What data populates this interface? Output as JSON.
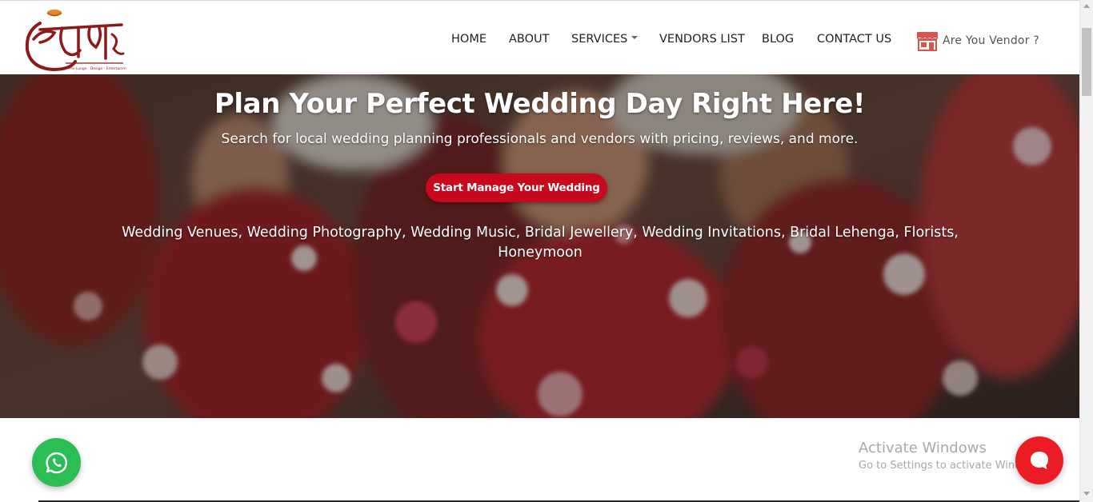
{
  "header": {
    "logo_alt": "शुभारंभ",
    "nav": [
      {
        "label": "HOME"
      },
      {
        "label": "ABOUT"
      },
      {
        "label": "SERVICES",
        "has_dropdown": true
      },
      {
        "label": "VENDORS LIST"
      },
      {
        "label": "BLOG"
      },
      {
        "label": "CONTACT US"
      }
    ],
    "vendor_link": {
      "label": "Are You Vendor ?",
      "icon": "store-icon"
    }
  },
  "hero": {
    "title": "Plan Your Perfect Wedding Day Right Here!",
    "subtitle": "Search for local wedding planning professionals and vendors with pricing, reviews, and more.",
    "cta_label": "Start Manage Your Wedding",
    "categories": "Wedding Venues, Wedding Photography, Wedding Music, Bridal Jewellery, Wedding Invitations, Bridal Lehenga, Florists, Honeymoon"
  },
  "floating": {
    "whatsapp_icon": "whatsapp-icon",
    "chat_icon": "chat-bubble-icon"
  },
  "os_watermark": {
    "line1": "Activate Windows",
    "line2": "Go to Settings to activate Windows."
  },
  "colors": {
    "brand_red": "#c8081c",
    "logo_maroon": "#8b1a1a",
    "whatsapp_green": "#2dbd55",
    "chat_red": "#ec1c24"
  }
}
